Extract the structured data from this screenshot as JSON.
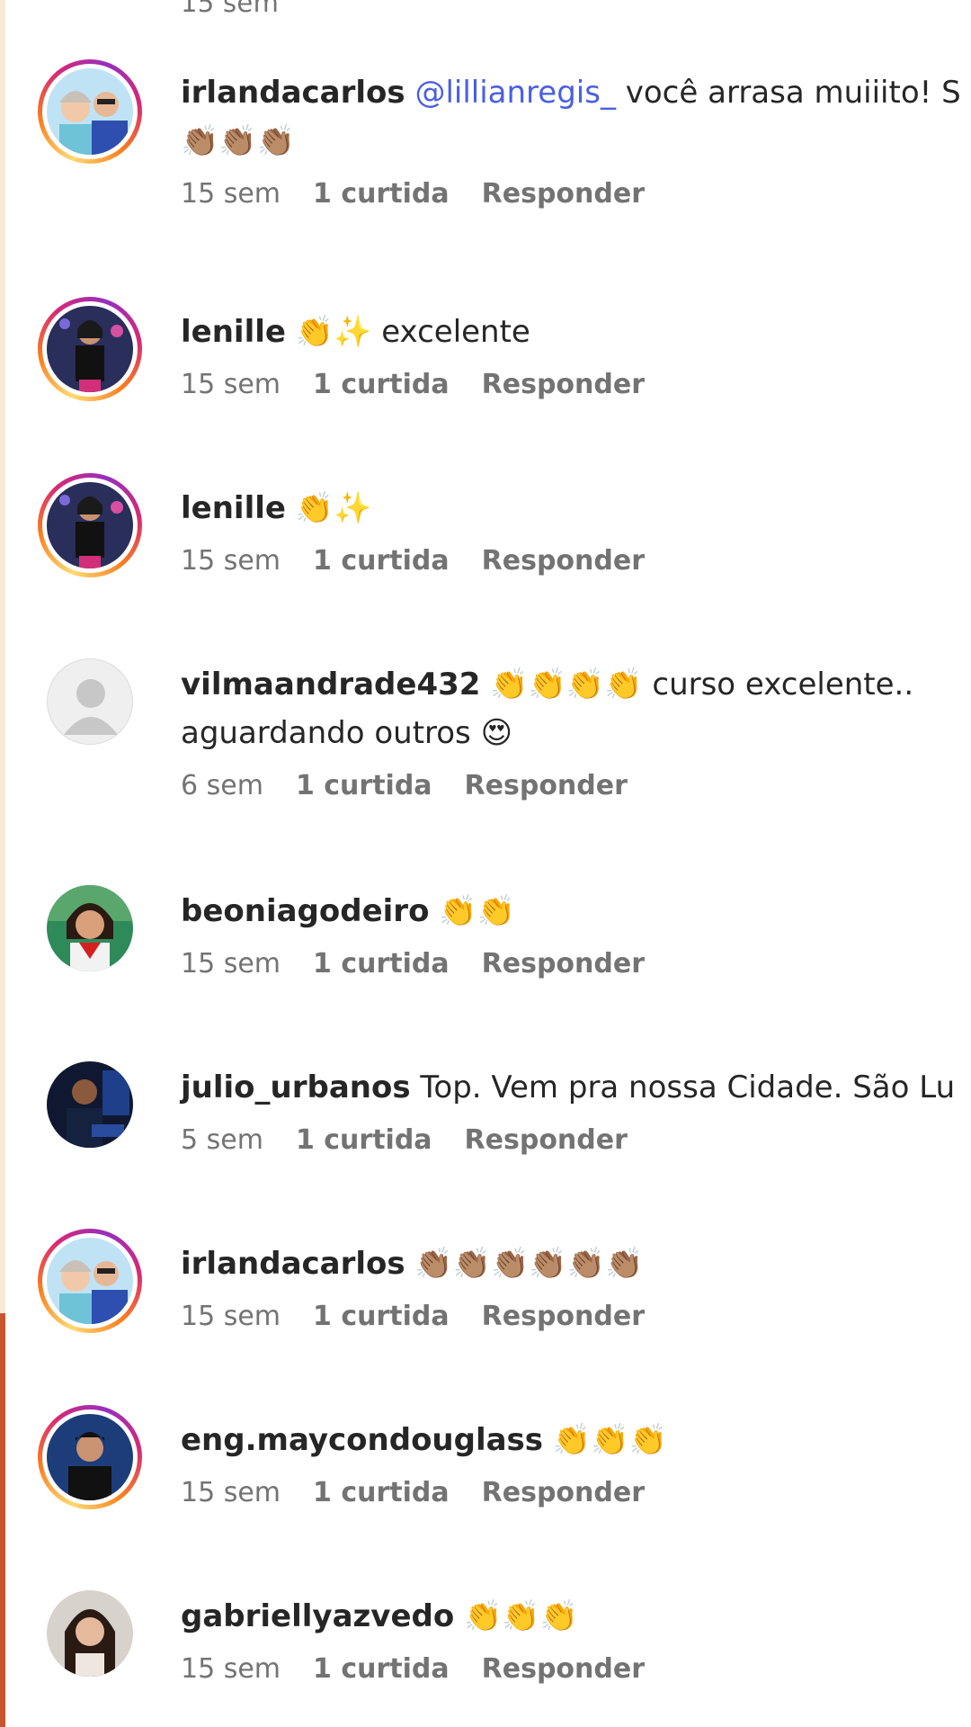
{
  "top_partial_time": "15 sem",
  "comments": [
    {
      "username": "irlandacarlos",
      "mention": "@lillianregis_",
      "text": " você arrasa muiiito! S",
      "line2": "👏🏽👏🏽👏🏽",
      "time": "15 sem",
      "likes": "1 curtida",
      "reply": "Responder"
    },
    {
      "username": "lenille",
      "text": " 👏✨ excelente",
      "time": "15 sem",
      "likes": "1 curtida",
      "reply": "Responder"
    },
    {
      "username": "lenille",
      "text": " 👏✨",
      "time": "15 sem",
      "likes": "1 curtida",
      "reply": "Responder"
    },
    {
      "username": "vilmaandrade432",
      "text": " 👏👏👏👏 curso excelente.. ",
      "line2": "aguardando outros 😍",
      "time": "6 sem",
      "likes": "1 curtida",
      "reply": "Responder"
    },
    {
      "username": "beoniagodeiro",
      "text": " 👏👏",
      "time": "15 sem",
      "likes": "1 curtida",
      "reply": "Responder"
    },
    {
      "username": "julio_urbanos",
      "text": " Top. Vem pra nossa Cidade. São Lu",
      "time": "5 sem",
      "likes": "1 curtida",
      "reply": "Responder"
    },
    {
      "username": "irlandacarlos",
      "text": " 👏🏽👏🏽👏🏽👏🏽👏🏽👏🏽",
      "time": "15 sem",
      "likes": "1 curtida",
      "reply": "Responder"
    },
    {
      "username": "eng.maycondouglass",
      "text": " 👏👏👏",
      "time": "15 sem",
      "likes": "1 curtida",
      "reply": "Responder"
    },
    {
      "username": "gabriellyazvedo",
      "text": " 👏👏👏",
      "time": "15 sem",
      "likes": "1 curtida",
      "reply": "Responder"
    }
  ],
  "colors": {
    "mention": "#4a5fe3",
    "meta": "#737373",
    "text": "#262626"
  }
}
